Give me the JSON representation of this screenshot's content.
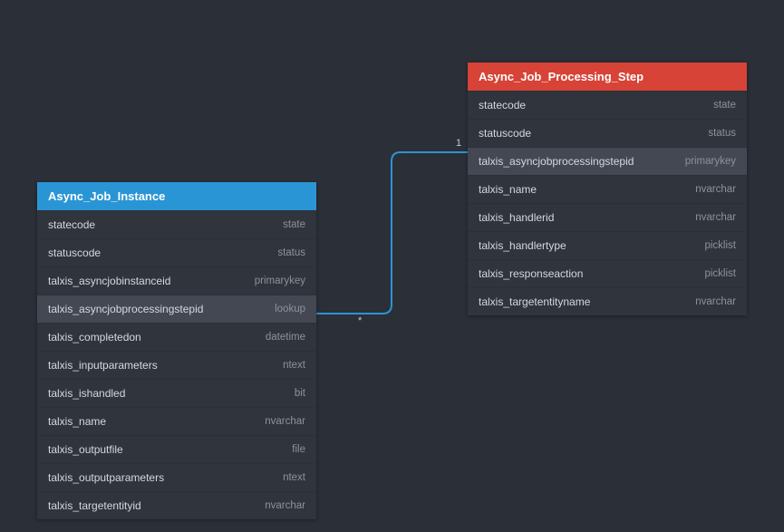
{
  "entities": {
    "asyncJobInstance": {
      "title": "Async_Job_Instance",
      "attrs": [
        {
          "name": "statecode",
          "type": "state"
        },
        {
          "name": "statuscode",
          "type": "status"
        },
        {
          "name": "talxis_asyncjobinstanceid",
          "type": "primarykey"
        },
        {
          "name": "talxis_asyncjobprocessingstepid",
          "type": "lookup"
        },
        {
          "name": "talxis_completedon",
          "type": "datetime"
        },
        {
          "name": "talxis_inputparameters",
          "type": "ntext"
        },
        {
          "name": "talxis_ishandled",
          "type": "bit"
        },
        {
          "name": "talxis_name",
          "type": "nvarchar"
        },
        {
          "name": "talxis_outputfile",
          "type": "file"
        },
        {
          "name": "talxis_outputparameters",
          "type": "ntext"
        },
        {
          "name": "talxis_targetentityid",
          "type": "nvarchar"
        }
      ]
    },
    "asyncJobProcessingStep": {
      "title": "Async_Job_Processing_Step",
      "attrs": [
        {
          "name": "statecode",
          "type": "state"
        },
        {
          "name": "statuscode",
          "type": "status"
        },
        {
          "name": "talxis_asyncjobprocessingstepid",
          "type": "primarykey"
        },
        {
          "name": "talxis_name",
          "type": "nvarchar"
        },
        {
          "name": "talxis_handlerid",
          "type": "nvarchar"
        },
        {
          "name": "talxis_handlertype",
          "type": "picklist"
        },
        {
          "name": "talxis_responseaction",
          "type": "picklist"
        },
        {
          "name": "talxis_targetentityname",
          "type": "nvarchar"
        }
      ]
    }
  },
  "relation": {
    "leftCardinality": "*",
    "rightCardinality": "1"
  }
}
